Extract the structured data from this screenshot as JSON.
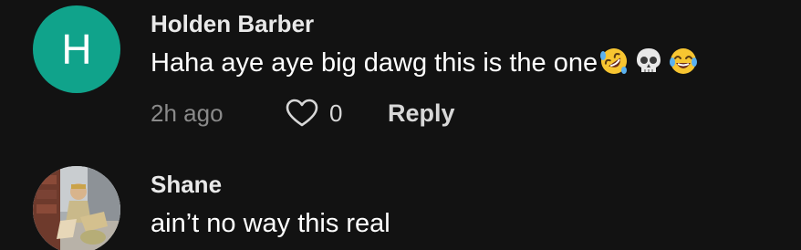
{
  "comments": [
    {
      "author": "Holden Barber",
      "avatar_initial": "H",
      "avatar_color": "#10a38b",
      "text": "Haha aye aye big dawg this is the one",
      "emojis": [
        "rolling-on-floor-laughing",
        "skull",
        "face-with-tears-of-joy"
      ],
      "time": "2h ago",
      "likes": "0",
      "reply_label": "Reply"
    },
    {
      "author": "Shane",
      "avatar_type": "photo",
      "text": "ain’t no way this real"
    }
  ],
  "colors": {
    "background": "#121212",
    "text": "#ffffff",
    "muted": "#8a8a8a"
  }
}
